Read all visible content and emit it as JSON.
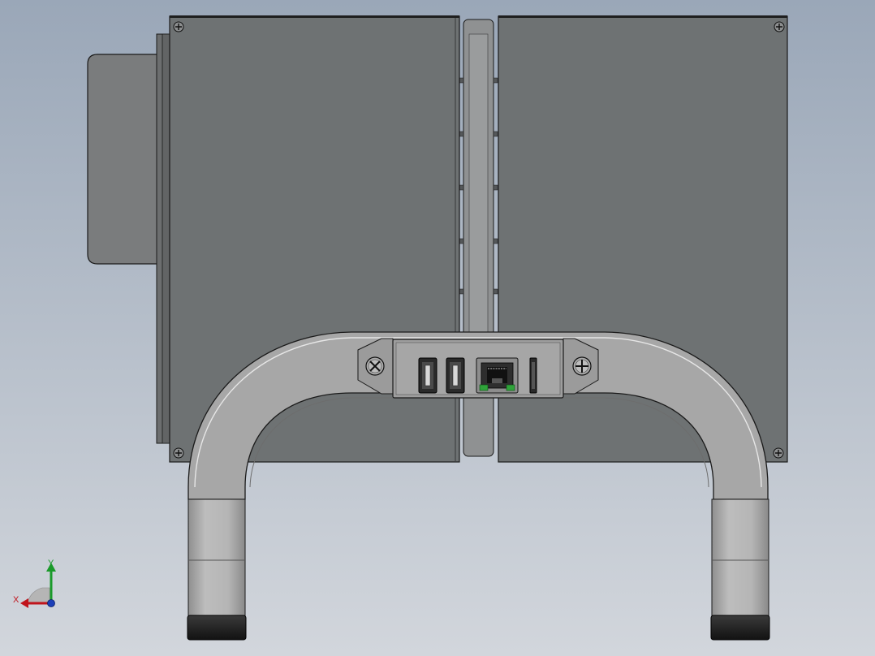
{
  "viewport": {
    "background_top": "#9aa7b8",
    "background_bottom": "#d2d6dc"
  },
  "model": {
    "housing_color": "#6e7273",
    "edge_color": "#1a1a1a",
    "handle_color": "#a3a3a3",
    "foot_color": "#1c1c1c",
    "port_highlight_color": "#2fa33a"
  },
  "triad": {
    "x_label": "X",
    "y_label": "Y",
    "x_color": "#c0141c",
    "y_color": "#1a9a2a",
    "z_color": "#1c3fb8"
  }
}
